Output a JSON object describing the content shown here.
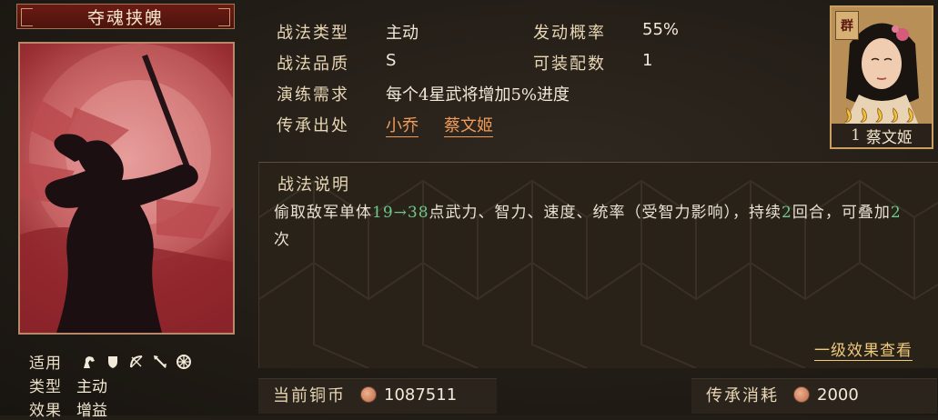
{
  "skill": {
    "name": "夺魂挟魄"
  },
  "stats": {
    "type_label": "战法类型",
    "type_value": "主动",
    "rate_label": "发动概率",
    "rate_value": "55%",
    "quality_label": "战法品质",
    "quality_value": "S",
    "slots_label": "可装配数",
    "slots_value": "1",
    "drill_label": "演练需求",
    "drill_value": "每个4星武将增加5%进度",
    "inherit_label": "传承出处",
    "inherit_sources": [
      "小乔",
      "蔡文姬"
    ]
  },
  "portrait": {
    "faction": "群",
    "level": "1",
    "name": "蔡文姬",
    "star_count": 5
  },
  "description": {
    "title": "战法说明",
    "text_1": "偷取敌军单体",
    "range": "19→38",
    "text_2": "点武力、智力、速度、统率（受智力影响），持续",
    "turns": "2",
    "text_3": "回合，可叠加",
    "stacks": "2",
    "text_4": "次",
    "effect_link": "一级效果查看"
  },
  "info": {
    "apply_label": "适用",
    "type_label": "类型",
    "type_value": "主动",
    "effect_label": "效果",
    "effect_value": "增益",
    "troop_icons": [
      "cavalry-icon",
      "shield-icon",
      "bow-icon",
      "spear-icon",
      "siege-icon"
    ]
  },
  "footer": {
    "coins_label": "当前铜币",
    "coins_value": "1087511",
    "cost_label": "传承消耗",
    "cost_value": "2000"
  },
  "colors": {
    "accent_orange": "#f09b5a",
    "highlight_green": "#6ec98a",
    "link_gold": "#f0c97a"
  }
}
